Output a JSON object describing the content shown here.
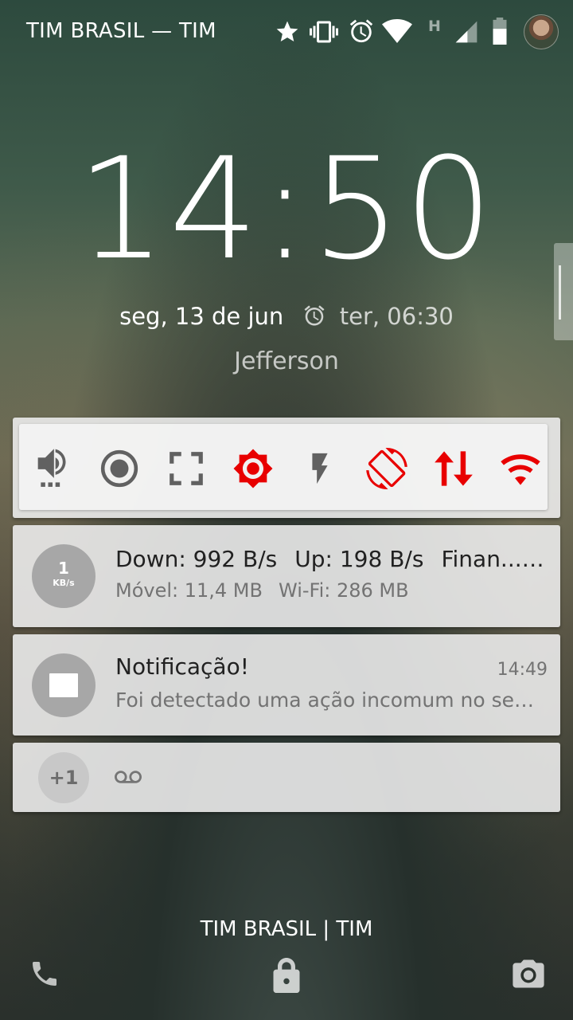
{
  "status_bar": {
    "carrier": "TIM BRASIL — TIM",
    "icons": [
      "star-icon",
      "vibrate-icon",
      "alarm-icon",
      "wifi-icon",
      "network-type-h-icon",
      "signal-icon",
      "battery-icon",
      "avatar"
    ],
    "network_type": "H"
  },
  "lockscreen": {
    "time": "14:50",
    "date": "seg, 13 de jun",
    "next_alarm": "ter, 06:30",
    "owner_info": "Jefferson"
  },
  "quick_settings": {
    "toggles": [
      {
        "name": "sound",
        "icon": "volume-icon",
        "active": false
      },
      {
        "name": "record",
        "icon": "record-icon",
        "active": false
      },
      {
        "name": "screenshot",
        "icon": "fullscreen-icon",
        "active": false
      },
      {
        "name": "brightness",
        "icon": "brightness-icon",
        "active": true
      },
      {
        "name": "flashlight",
        "icon": "flash-icon",
        "active": false
      },
      {
        "name": "auto-rotate",
        "icon": "rotate-icon",
        "active": true
      },
      {
        "name": "mobile-data",
        "icon": "data-arrows-icon",
        "active": true
      },
      {
        "name": "wifi",
        "icon": "wifi-icon",
        "active": true
      }
    ],
    "active_color": "#e80000",
    "inactive_color": "#616161"
  },
  "network_notification": {
    "speed_value": "1",
    "speed_unit": "KB/s",
    "down": "Down: 992 B/s",
    "up": "Up: 198 B/s",
    "app": "Finan....",
    "mobile_usage": "Móvel: 11,4 MB",
    "wifi_usage": "Wi-Fi: 286 MB"
  },
  "alert_notification": {
    "title": "Notificação!",
    "time": "14:49",
    "text": "Foi detectado uma ação incomum no seu.."
  },
  "more_notifications": {
    "count": "+1",
    "icon": "voicemail-icon"
  },
  "bottom": {
    "carrier": "TIM BRASIL | TIM",
    "left_icon": "phone-icon",
    "center_icon": "lock-icon",
    "right_icon": "camera-icon"
  }
}
